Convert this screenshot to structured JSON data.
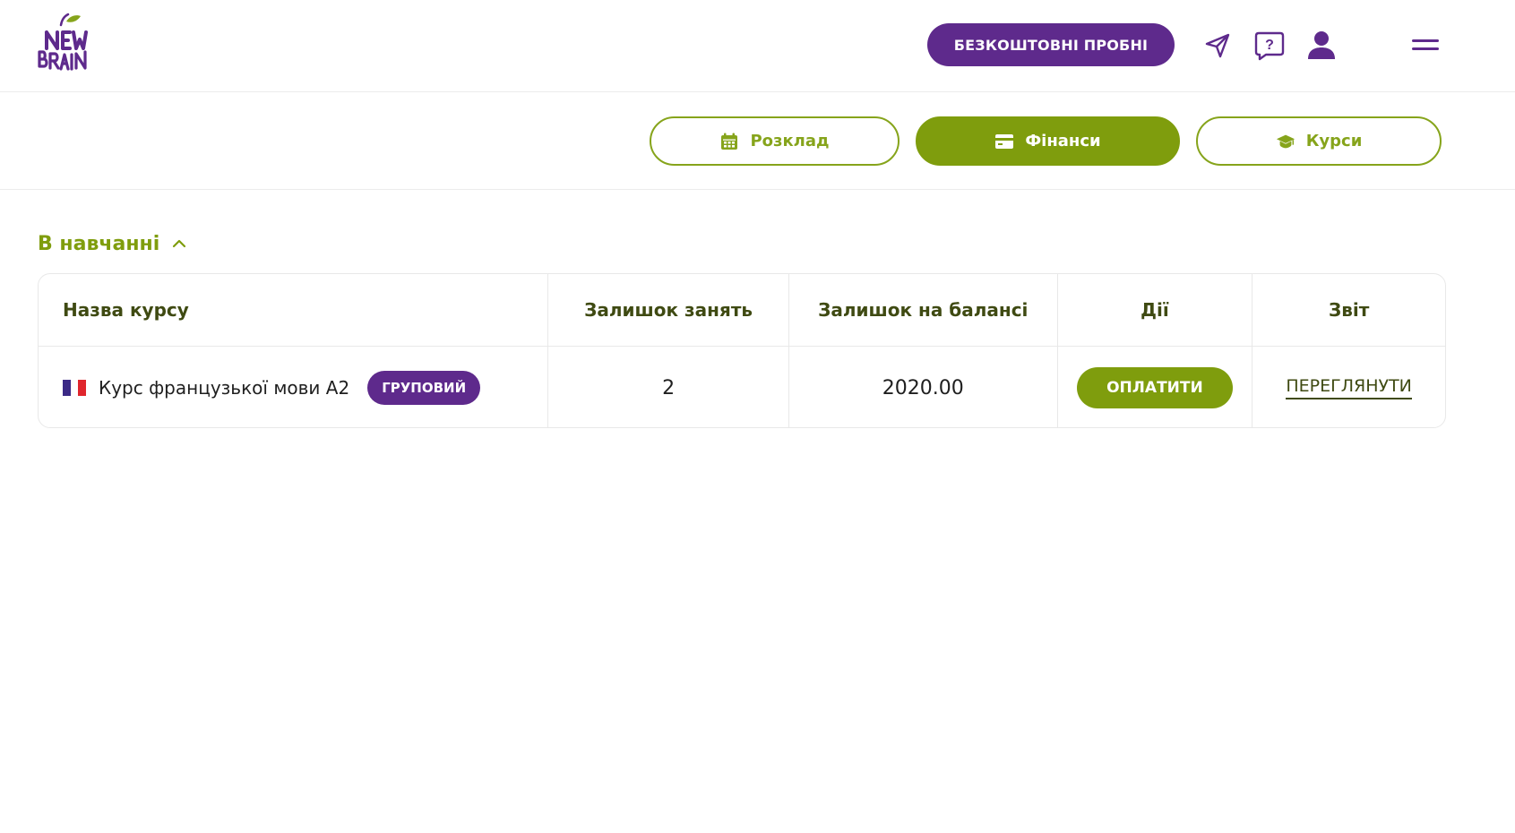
{
  "header": {
    "logo_text": "NEW BRAIN",
    "trial_button": "БЕЗКОШТОВНІ ПРОБНІ",
    "icons": [
      "send-icon",
      "help-chat-icon",
      "user-icon",
      "menu-icon"
    ],
    "help_glyph": "?"
  },
  "tabs": {
    "schedule": "Розклад",
    "finance": "Фінанси",
    "courses": "Курси",
    "active": "finance"
  },
  "section": {
    "title": "В навчанні",
    "expanded": true
  },
  "table": {
    "headers": {
      "course_name": "Назва курсу",
      "lessons_left": "Залишок занять",
      "balance_left": "Залишок на балансі",
      "actions": "Дії",
      "report": "Звіт"
    },
    "rows": [
      {
        "flag": "france-flag",
        "course": "Курс французької мови А2",
        "type_badge": "ГРУПОВИЙ",
        "lessons_left": "2",
        "balance": "2020.00",
        "pay_button": "ОПЛАТИТИ",
        "report_link": "ПЕРЕГЛЯНУТИ"
      }
    ]
  },
  "colors": {
    "brand_purple": "#5e2a8c",
    "brand_green": "#7f9d0d",
    "dark_olive_text": "#3f4a12"
  }
}
